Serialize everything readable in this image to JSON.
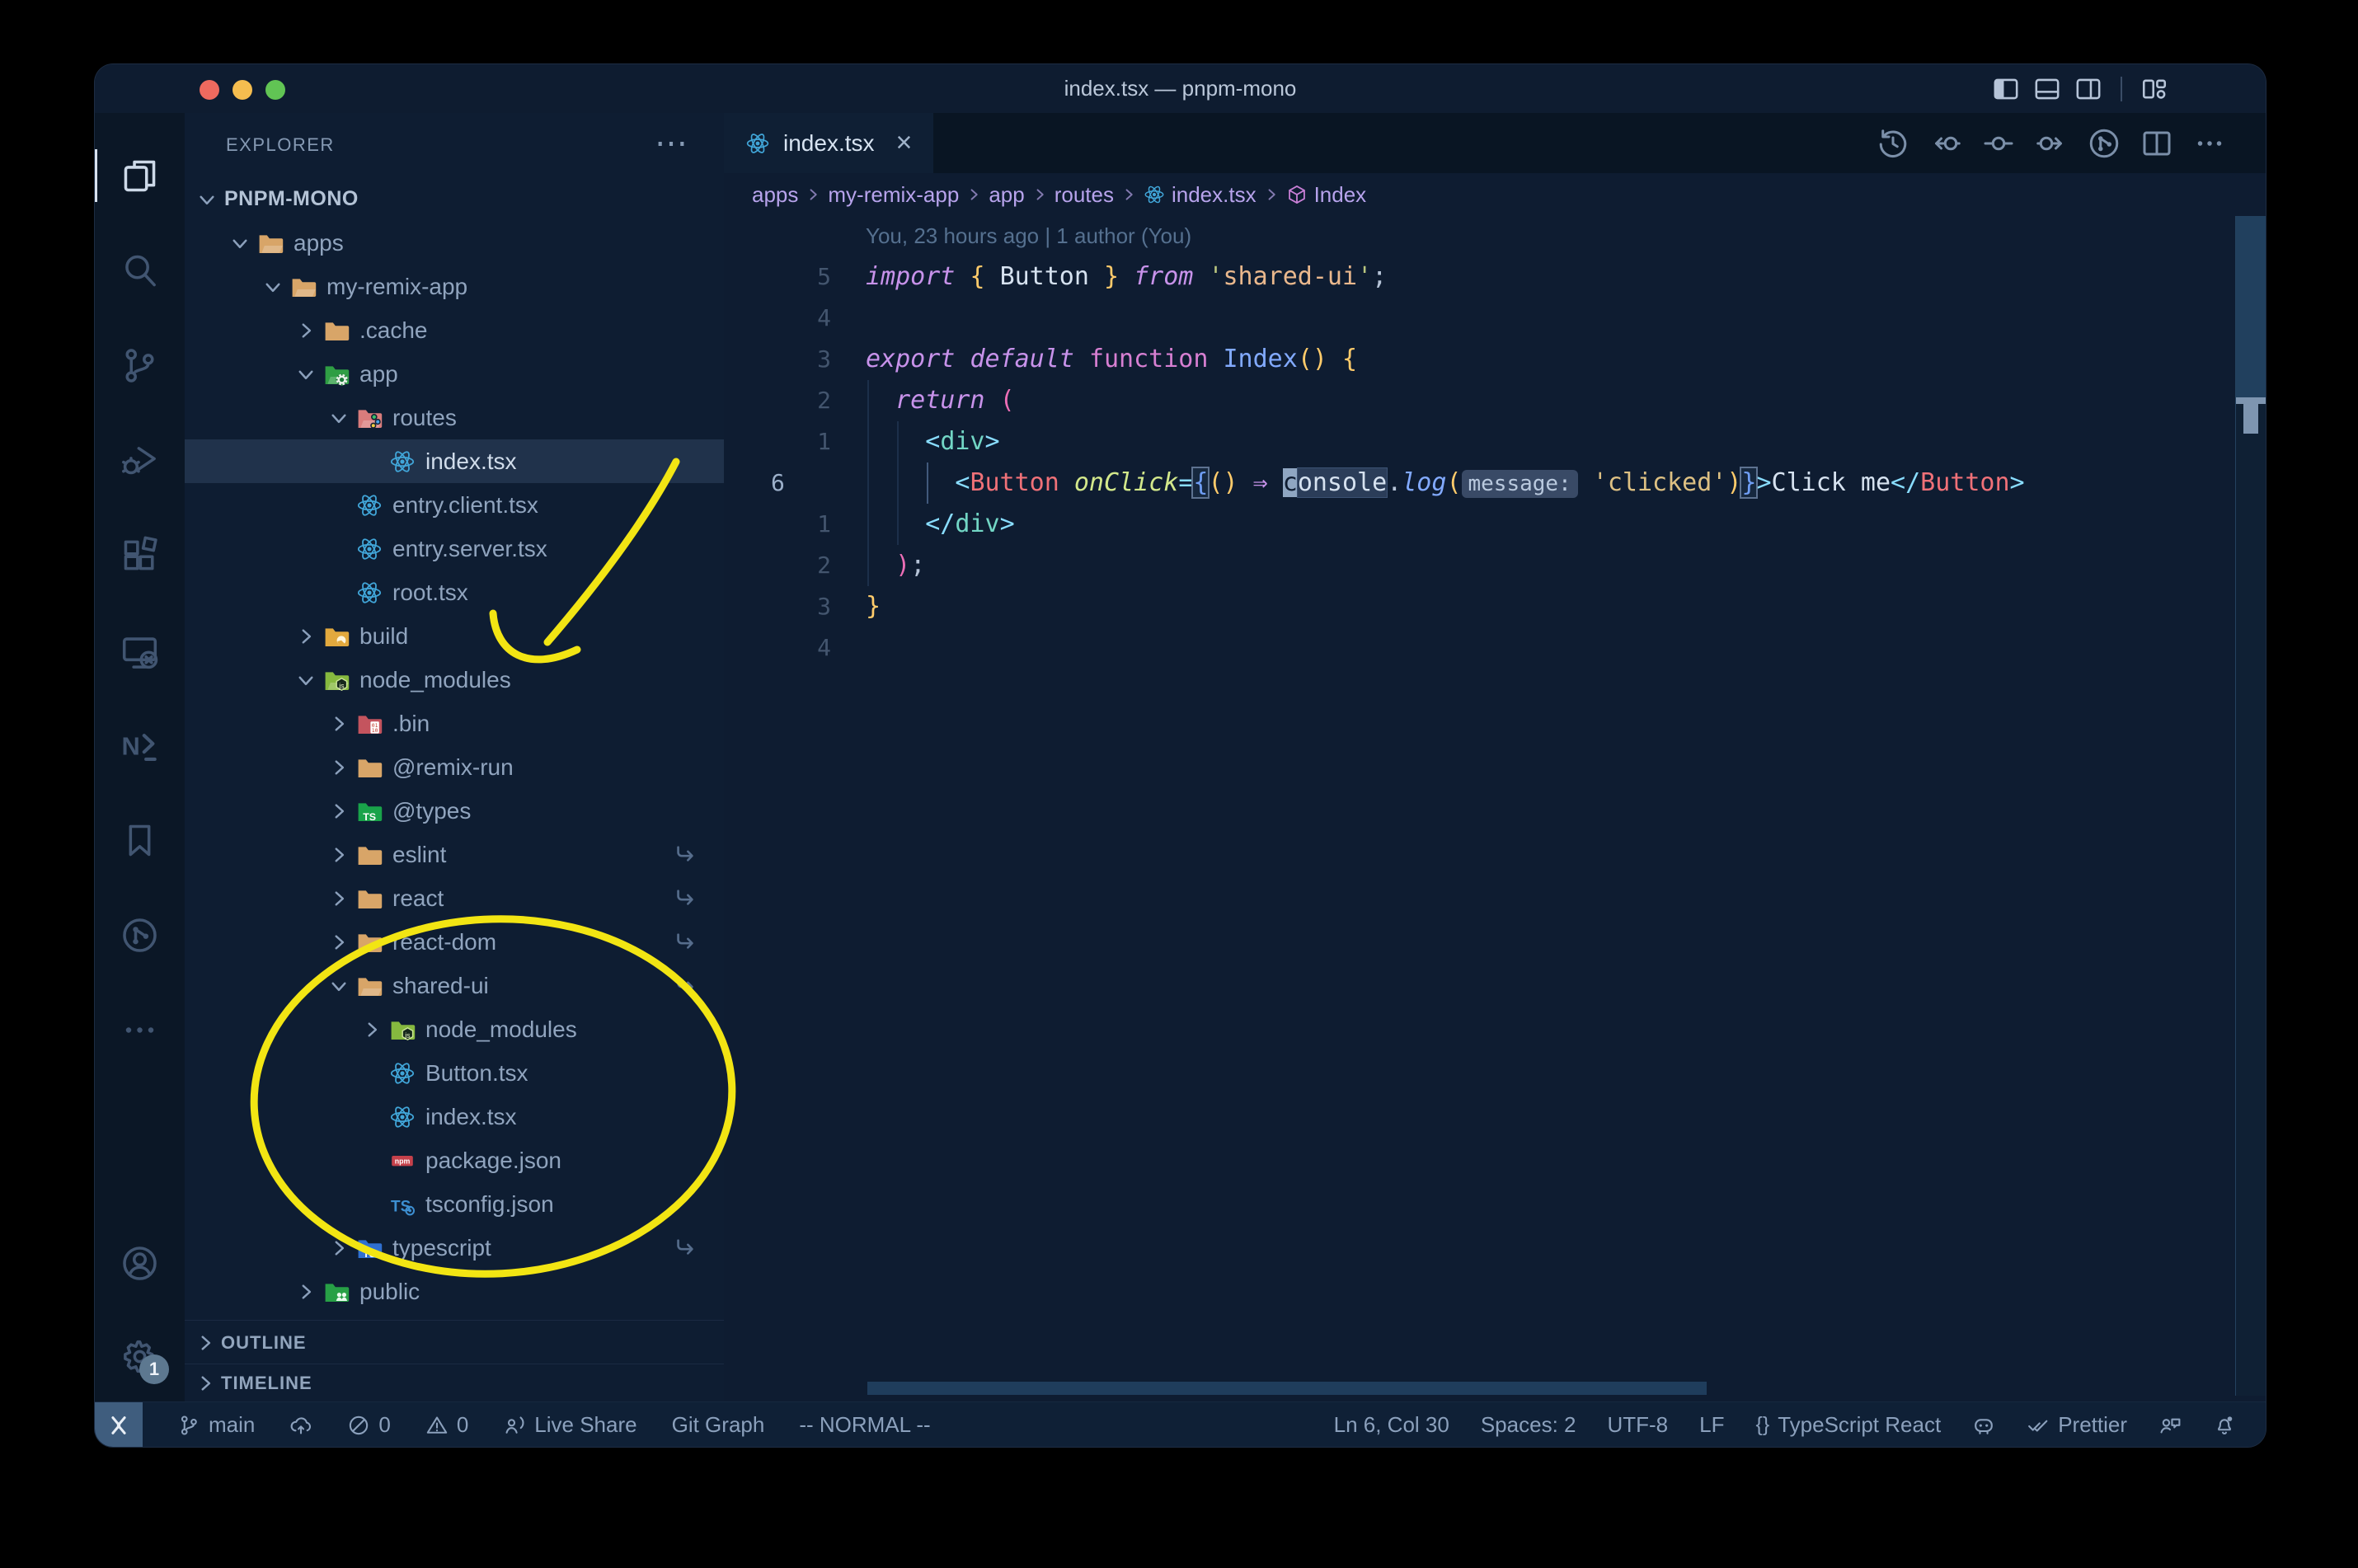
{
  "window": {
    "title": "index.tsx — pnpm-mono",
    "traffic_lights": [
      "close",
      "minimize",
      "zoom"
    ],
    "layout_icons": [
      "layout-sidebar",
      "layout-panel",
      "layout-split",
      "layout-custom"
    ]
  },
  "colors": {
    "annotation_yellow": "#f2e513",
    "traffic_red": "#ee6a5f",
    "traffic_yellow": "#f5bd4f",
    "traffic_green": "#61c454",
    "editor_bg": "#0e1c31",
    "sidebar_bg": "#0e1d32",
    "statusbar_bg": "#0f2036"
  },
  "activity_bar": {
    "top": [
      {
        "name": "explorer",
        "active": true
      },
      {
        "name": "search"
      },
      {
        "name": "source-control"
      },
      {
        "name": "run-debug"
      },
      {
        "name": "extensions"
      },
      {
        "name": "remote-explorer"
      },
      {
        "name": "nx-console"
      },
      {
        "name": "bookmarks"
      },
      {
        "name": "git-graph"
      },
      {
        "name": "more"
      }
    ],
    "bottom": [
      {
        "name": "account"
      },
      {
        "name": "settings",
        "badge": "1"
      }
    ]
  },
  "sidebar": {
    "header": {
      "title": "EXPLORER",
      "more_glyph": "⋯"
    },
    "tree": [
      {
        "label": "PNPM-MONO",
        "depth": 0,
        "chev": "down",
        "icon": null,
        "root": true
      },
      {
        "label": "apps",
        "depth": 1,
        "chev": "down",
        "icon": "folder-open"
      },
      {
        "label": "my-remix-app",
        "depth": 2,
        "chev": "down",
        "icon": "folder-open"
      },
      {
        "label": ".cache",
        "depth": 3,
        "chev": "right",
        "icon": "folder"
      },
      {
        "label": "app",
        "depth": 3,
        "chev": "down",
        "icon": "folder-app"
      },
      {
        "label": "routes",
        "depth": 4,
        "chev": "down",
        "icon": "folder-routes"
      },
      {
        "label": "index.tsx",
        "depth": 5,
        "chev": null,
        "icon": "react",
        "selected": true
      },
      {
        "label": "entry.client.tsx",
        "depth": 4,
        "chev": null,
        "icon": "react"
      },
      {
        "label": "entry.server.tsx",
        "depth": 4,
        "chev": null,
        "icon": "react"
      },
      {
        "label": "root.tsx",
        "depth": 4,
        "chev": null,
        "icon": "react"
      },
      {
        "label": "build",
        "depth": 3,
        "chev": "right",
        "icon": "folder-build"
      },
      {
        "label": "node_modules",
        "depth": 3,
        "chev": "down",
        "icon": "folder-nm-open"
      },
      {
        "label": ".bin",
        "depth": 4,
        "chev": "right",
        "icon": "folder-bin"
      },
      {
        "label": "@remix-run",
        "depth": 4,
        "chev": "right",
        "icon": "folder"
      },
      {
        "label": "@types",
        "depth": 4,
        "chev": "right",
        "icon": "folder-ts-green"
      },
      {
        "label": "eslint",
        "depth": 4,
        "chev": "right",
        "icon": "folder",
        "symlink": true
      },
      {
        "label": "react",
        "depth": 4,
        "chev": "right",
        "icon": "folder",
        "symlink": true
      },
      {
        "label": "react-dom",
        "depth": 4,
        "chev": "right",
        "icon": "folder",
        "symlink": true
      },
      {
        "label": "shared-ui",
        "depth": 4,
        "chev": "down",
        "icon": "folder-open",
        "symlink": true
      },
      {
        "label": "node_modules",
        "depth": 5,
        "chev": "right",
        "icon": "folder-nm"
      },
      {
        "label": "Button.tsx",
        "depth": 5,
        "chev": null,
        "icon": "react"
      },
      {
        "label": "index.tsx",
        "depth": 5,
        "chev": null,
        "icon": "react"
      },
      {
        "label": "package.json",
        "depth": 5,
        "chev": null,
        "icon": "npm"
      },
      {
        "label": "tsconfig.json",
        "depth": 5,
        "chev": null,
        "icon": "tsconfig"
      },
      {
        "label": "typescript",
        "depth": 4,
        "chev": "right",
        "icon": "folder-ts-blue",
        "symlink": true
      },
      {
        "label": "public",
        "depth": 3,
        "chev": "right",
        "icon": "folder-public"
      }
    ],
    "sections": [
      {
        "label": "OUTLINE"
      },
      {
        "label": "TIMELINE"
      }
    ]
  },
  "tabs": [
    {
      "label": "index.tsx",
      "icon": "react",
      "close_glyph": "×",
      "active": true
    }
  ],
  "editor_toolbar": [
    {
      "name": "timeline-history"
    },
    {
      "name": "previous-change"
    },
    {
      "name": "current-change"
    },
    {
      "name": "next-change"
    },
    {
      "name": "git-graph-view"
    },
    {
      "name": "split-editor"
    },
    {
      "name": "more-actions"
    }
  ],
  "breadcrumbs": [
    {
      "label": "apps"
    },
    {
      "label": "my-remix-app"
    },
    {
      "label": "app"
    },
    {
      "label": "routes"
    },
    {
      "label": "index.tsx",
      "icon": "react"
    },
    {
      "label": "Index",
      "icon": "cube"
    }
  ],
  "editor": {
    "blame": "You, 23 hours ago | 1 author (You)",
    "lines": [
      {
        "num": "5",
        "tokens": [
          {
            "t": "import",
            "s": "kw"
          },
          {
            "t": " "
          },
          {
            "t": "{",
            "s": "p1"
          },
          {
            "t": " "
          },
          {
            "t": "Button",
            "s": "fg"
          },
          {
            "t": " "
          },
          {
            "t": "}",
            "s": "p1"
          },
          {
            "t": " "
          },
          {
            "t": "from",
            "s": "kw"
          },
          {
            "t": " "
          },
          {
            "t": "'",
            "s": "q"
          },
          {
            "t": "shared-ui",
            "s": "str2"
          },
          {
            "t": "'",
            "s": "q"
          },
          {
            "t": ";",
            "s": "punc"
          }
        ]
      },
      {
        "num": "4",
        "tokens": []
      },
      {
        "num": "3",
        "tokens": [
          {
            "t": "export",
            "s": "kw"
          },
          {
            "t": " "
          },
          {
            "t": "default",
            "s": "kw"
          },
          {
            "t": " "
          },
          {
            "t": "function",
            "s": "kw2"
          },
          {
            "t": " "
          },
          {
            "t": "Index",
            "s": "cls"
          },
          {
            "t": "()",
            "s": "p1"
          },
          {
            "t": " "
          },
          {
            "t": "{",
            "s": "p1"
          }
        ]
      },
      {
        "num": "2",
        "guides": [
          {
            "col": 0
          }
        ],
        "tokens": [
          {
            "t": "  "
          },
          {
            "t": "return",
            "s": "kw"
          },
          {
            "t": " "
          },
          {
            "t": "(",
            "s": "p2"
          }
        ]
      },
      {
        "num": "1",
        "guides": [
          {
            "col": 0
          },
          {
            "col": 1
          }
        ],
        "tokens": [
          {
            "t": "    "
          },
          {
            "t": "<",
            "s": "op"
          },
          {
            "t": "div",
            "s": "el"
          },
          {
            "t": ">",
            "s": "op"
          }
        ]
      },
      {
        "num": "6",
        "current": true,
        "guides": [
          {
            "col": 0
          },
          {
            "col": 1
          },
          {
            "col": 2,
            "active": true
          }
        ],
        "tokens": [
          {
            "t": "      "
          },
          {
            "t": "<",
            "s": "op"
          },
          {
            "t": "Button",
            "s": "tag"
          },
          {
            "t": " "
          },
          {
            "t": "onClick",
            "s": "attr"
          },
          {
            "t": "=",
            "s": "op"
          },
          {
            "t": "{",
            "s": "p3 match"
          },
          {
            "t": "()",
            "s": "p1"
          },
          {
            "t": " "
          },
          {
            "t": "⇒",
            "s": "kw"
          },
          {
            "t": " "
          },
          {
            "t": "c",
            "s": "cursor"
          },
          {
            "t": "onsole",
            "s": "fg hl"
          },
          {
            "t": ".",
            "s": "punc"
          },
          {
            "t": "log",
            "s": "fn"
          },
          {
            "t": "(",
            "s": "p1"
          },
          {
            "t": "message:",
            "s": "inlay"
          },
          {
            "t": " "
          },
          {
            "t": "'clicked'",
            "s": "str"
          },
          {
            "t": ")",
            "s": "p1"
          },
          {
            "t": "}",
            "s": "p3 match"
          },
          {
            "t": ">",
            "s": "op"
          },
          {
            "t": "Click me",
            "s": "fg"
          },
          {
            "t": "</",
            "s": "op"
          },
          {
            "t": "Button",
            "s": "tag"
          },
          {
            "t": ">",
            "s": "op"
          }
        ]
      },
      {
        "num": "1",
        "guides": [
          {
            "col": 0
          },
          {
            "col": 1
          }
        ],
        "tokens": [
          {
            "t": "    "
          },
          {
            "t": "</",
            "s": "op"
          },
          {
            "t": "div",
            "s": "el"
          },
          {
            "t": ">",
            "s": "op"
          }
        ]
      },
      {
        "num": "2",
        "guides": [
          {
            "col": 0
          }
        ],
        "tokens": [
          {
            "t": "  "
          },
          {
            "t": ")",
            "s": "p2"
          },
          {
            "t": ";",
            "s": "punc"
          }
        ]
      },
      {
        "num": "3",
        "tokens": [
          {
            "t": "}",
            "s": "p1"
          }
        ]
      },
      {
        "num": "4",
        "tokens": []
      }
    ]
  },
  "status_bar": {
    "left": [
      {
        "name": "remote-indicator",
        "icon": "remote",
        "box": true
      },
      {
        "name": "git-branch",
        "icon": "branch",
        "label": "main"
      },
      {
        "name": "sync-changes",
        "icon": "cloud-up"
      },
      {
        "name": "errors",
        "icon": "error",
        "label": "0"
      },
      {
        "name": "warnings",
        "icon": "warning",
        "label": "0"
      },
      {
        "name": "live-share",
        "icon": "liveshare",
        "label": "Live Share"
      },
      {
        "name": "git-graph",
        "label": "Git Graph"
      },
      {
        "name": "vim-mode",
        "label": "-- NORMAL --"
      }
    ],
    "right": [
      {
        "name": "cursor-position",
        "label": "Ln 6, Col 30"
      },
      {
        "name": "indentation",
        "label": "Spaces: 2"
      },
      {
        "name": "encoding",
        "label": "UTF-8"
      },
      {
        "name": "eol",
        "label": "LF"
      },
      {
        "name": "language-mode",
        "icon": "braces",
        "label": "TypeScript React"
      },
      {
        "name": "copilot",
        "icon": "copilot"
      },
      {
        "name": "formatter",
        "icon": "checks",
        "label": "Prettier"
      },
      {
        "name": "feedback",
        "icon": "feedback"
      },
      {
        "name": "notifications",
        "icon": "bell-dot"
      }
    ]
  }
}
